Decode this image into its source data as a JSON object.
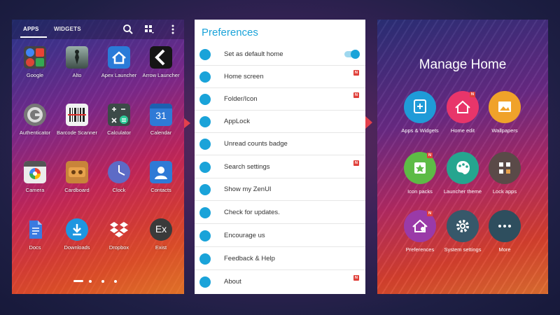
{
  "drawer": {
    "tabs": {
      "apps": "APPS",
      "widgets": "WIDGETS"
    },
    "toolbar_icons": [
      "search-icon",
      "view-toggle-icon",
      "more-icon"
    ],
    "apps": [
      {
        "label": "Google",
        "icon": "google-folder-icon"
      },
      {
        "label": "Alto",
        "icon": "alto-icon"
      },
      {
        "label": "Apex Launcher",
        "icon": "apex-launcher-icon"
      },
      {
        "label": "Arrow Launcher",
        "icon": "arrow-launcher-icon"
      },
      {
        "label": "Authenticator",
        "icon": "authenticator-icon"
      },
      {
        "label": "Barcode Scanner",
        "icon": "barcode-icon"
      },
      {
        "label": "Calculator",
        "icon": "calculator-icon"
      },
      {
        "label": "Calendar",
        "icon": "calendar-icon",
        "glyph": "31"
      },
      {
        "label": "Camera",
        "icon": "camera-icon"
      },
      {
        "label": "Cardboard",
        "icon": "cardboard-icon"
      },
      {
        "label": "Clock",
        "icon": "clock-icon"
      },
      {
        "label": "Contacts",
        "icon": "contacts-icon"
      },
      {
        "label": "Docs",
        "icon": "docs-icon"
      },
      {
        "label": "Downloads",
        "icon": "downloads-icon"
      },
      {
        "label": "Dropbox",
        "icon": "dropbox-icon"
      },
      {
        "label": "Exist",
        "icon": "exist-icon",
        "glyph": "Ex"
      }
    ]
  },
  "preferences": {
    "title": "Preferences",
    "accent": "#1aa3d9",
    "badge_text": "N",
    "items": [
      {
        "label": "Set as default home",
        "icon": "home-icon",
        "toggle": true,
        "toggle_on": true
      },
      {
        "label": "Home screen",
        "icon": "home-screen-icon",
        "badge": true
      },
      {
        "label": "Folder/Icon",
        "icon": "folder-icon",
        "badge": true
      },
      {
        "label": "AppLock",
        "icon": "applock-icon"
      },
      {
        "label": "Unread counts badge",
        "icon": "unread-badge-icon"
      },
      {
        "label": "Search settings",
        "icon": "search-settings-icon",
        "badge": true
      },
      {
        "label": "Show my ZenUI",
        "icon": "zenui-icon"
      },
      {
        "label": "Check for updates.",
        "icon": "update-icon"
      },
      {
        "label": "Encourage us",
        "icon": "thumbs-up-icon"
      },
      {
        "label": "Feedback & Help",
        "icon": "feedback-icon"
      },
      {
        "label": "About",
        "icon": "info-icon",
        "badge": true
      }
    ]
  },
  "manage_home": {
    "title": "Manage Home",
    "badge_text": "N",
    "items": [
      {
        "label": "Apps & Widgets",
        "icon": "apps-widgets-icon",
        "color": "#1f9bd8",
        "badge": false
      },
      {
        "label": "Home edit",
        "icon": "home-edit-icon",
        "color": "#e8356a",
        "badge": true
      },
      {
        "label": "Wallpapers",
        "icon": "wallpapers-icon",
        "color": "#f0a22a",
        "badge": false
      },
      {
        "label": "Icon packs",
        "icon": "icon-packs-icon",
        "color": "#5dbb46",
        "badge": true
      },
      {
        "label": "Launcher theme",
        "icon": "palette-icon",
        "color": "#25a58f",
        "badge": false
      },
      {
        "label": "Lock apps",
        "icon": "lock-apps-icon",
        "color": "#5a4a48",
        "badge": false
      },
      {
        "label": "Preferences",
        "icon": "preferences-icon",
        "color": "#9a3aa8",
        "badge": true
      },
      {
        "label": "System settings",
        "icon": "gear-icon",
        "color": "#37586a",
        "badge": false
      },
      {
        "label": "More",
        "icon": "more-dots-icon",
        "color": "#2e4e5e",
        "badge": false
      }
    ]
  }
}
